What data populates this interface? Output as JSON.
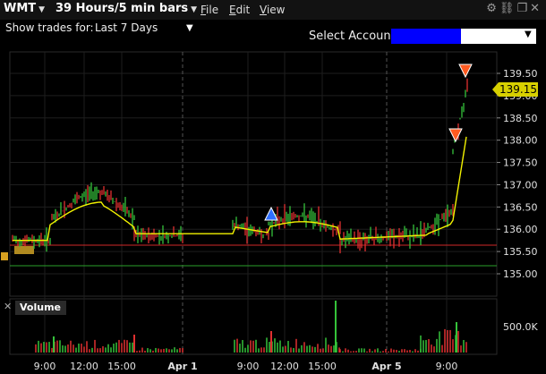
{
  "titlebar": {
    "symbol": "WMT",
    "bars": "39 Hours/5 min bars",
    "menu": [
      {
        "first": "F",
        "rest": "ile"
      },
      {
        "first": "E",
        "rest": "dit"
      },
      {
        "first": "V",
        "rest": "iew"
      }
    ],
    "icons": [
      "gear-icon",
      "link-icon",
      "restore-icon",
      "close-icon"
    ]
  },
  "toolbar": {
    "show_trades_label": "Show trades for:",
    "show_trades_value": "Last 7 Days",
    "select_account_label": "Select Account"
  },
  "price_axis": {
    "ticks": [
      "139.50",
      "139.00",
      "138.50",
      "138.00",
      "137.50",
      "137.00",
      "136.50",
      "136.00",
      "135.50",
      "135.00"
    ],
    "current_price": "139.15"
  },
  "volume": {
    "label": "Volume",
    "axis_tick": "500.0K"
  },
  "time_axis": {
    "ticks": [
      "9:00",
      "12:00",
      "15:00",
      "Apr 1",
      "9:00",
      "12:00",
      "15:00",
      "Apr 5",
      "9:00"
    ]
  },
  "colors": {
    "up": "#35c23a",
    "down": "#e03030",
    "ma_line": "#f2f200",
    "buy_marker": "#2f6fff",
    "sell_marker": "#ff5a20",
    "level_red": "#d02828",
    "level_green": "#2aa02a"
  }
}
